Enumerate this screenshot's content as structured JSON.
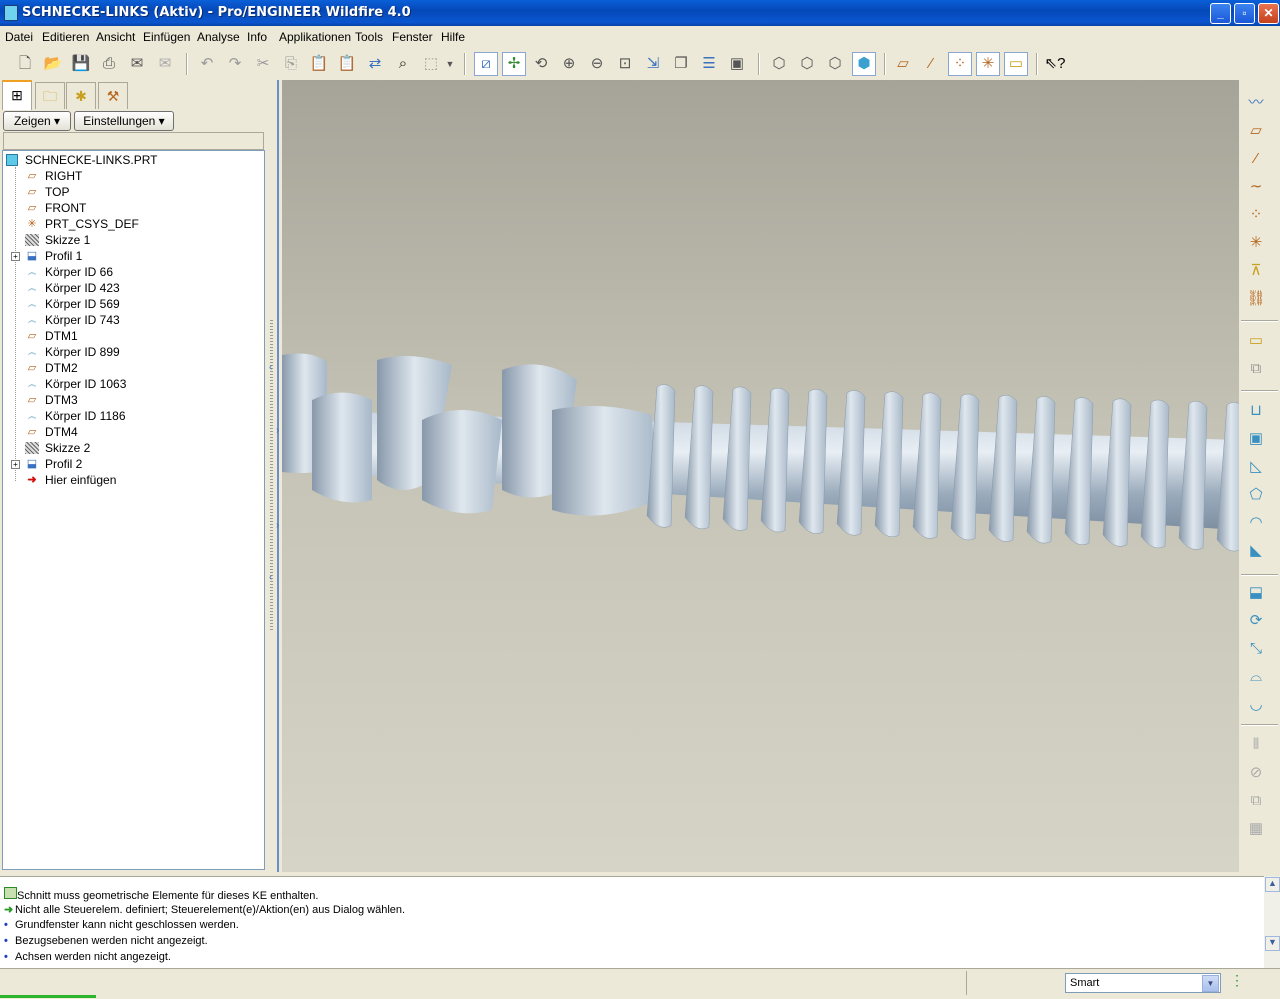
{
  "window": {
    "title": "SCHNECKE-LINKS (Aktiv) - Pro/ENGINEER Wildfire 4.0",
    "controls": [
      "minimize",
      "maximize",
      "close"
    ]
  },
  "menu": [
    "Datei",
    "Editieren",
    "Ansicht",
    "Einfügen",
    "Analyse",
    "Info",
    "Applikationen",
    "Tools",
    "Fenster",
    "Hilfe"
  ],
  "toolbar_icons": [
    "new-file-icon",
    "open-folder-icon",
    "save-icon",
    "print-icon",
    "email-icon",
    "email-link-icon",
    "undo-icon",
    "redo-icon",
    "cut-icon",
    "copy-icon",
    "paste-icon",
    "paste-special-icon",
    "regenerate-icon",
    "find-icon",
    "select-box-icon",
    "repaint-icon",
    "spin-center-icon",
    "orientation-icon",
    "zoom-in-icon",
    "zoom-out-icon",
    "refit-icon",
    "reorient-icon",
    "saved-views-icon",
    "layers-icon",
    "view-manager-icon",
    "wireframe-icon",
    "hidden-line-icon",
    "no-hidden-icon",
    "shading-icon",
    "datum-planes-icon",
    "datum-axes-icon",
    "datum-points-icon",
    "coord-systems-icon",
    "annotations-icon",
    "context-help-icon"
  ],
  "panel": {
    "tabs": [
      "model-tree-icon",
      "folder-browser-icon",
      "favorites-icon",
      "connections-icon"
    ],
    "show_button": "Zeigen",
    "settings_button": "Einstellungen"
  },
  "tree": {
    "root": "SCHNECKE-LINKS.PRT",
    "items": [
      {
        "label": "RIGHT",
        "icon": "datum-plane-icon",
        "expandable": false
      },
      {
        "label": "TOP",
        "icon": "datum-plane-icon",
        "expandable": false
      },
      {
        "label": "FRONT",
        "icon": "datum-plane-icon",
        "expandable": false
      },
      {
        "label": "PRT_CSYS_DEF",
        "icon": "coord-system-icon",
        "expandable": false
      },
      {
        "label": "Skizze 1",
        "icon": "sketch-icon",
        "expandable": false
      },
      {
        "label": "Profil 1",
        "icon": "extrude-icon",
        "expandable": true
      },
      {
        "label": "Körper ID 66",
        "icon": "helical-sweep-icon",
        "expandable": false
      },
      {
        "label": "Körper ID 423",
        "icon": "helical-sweep-icon",
        "expandable": false
      },
      {
        "label": "Körper ID 569",
        "icon": "helical-sweep-icon",
        "expandable": false
      },
      {
        "label": "Körper ID 743",
        "icon": "helical-sweep-icon",
        "expandable": false
      },
      {
        "label": "DTM1",
        "icon": "datum-plane-icon",
        "expandable": false
      },
      {
        "label": "Körper ID 899",
        "icon": "helical-sweep-icon",
        "expandable": false
      },
      {
        "label": "DTM2",
        "icon": "datum-plane-icon",
        "expandable": false
      },
      {
        "label": "Körper ID 1063",
        "icon": "helical-sweep-icon",
        "expandable": false
      },
      {
        "label": "DTM3",
        "icon": "datum-plane-icon",
        "expandable": false
      },
      {
        "label": "Körper ID 1186",
        "icon": "helical-sweep-icon",
        "expandable": false
      },
      {
        "label": "DTM4",
        "icon": "datum-plane-icon",
        "expandable": false
      },
      {
        "label": "Skizze 2",
        "icon": "sketch-icon",
        "expandable": false
      },
      {
        "label": "Profil 2",
        "icon": "extrude-icon",
        "expandable": true
      },
      {
        "label": "Hier einfügen",
        "icon": "insert-here-arrow-icon",
        "expandable": false
      }
    ]
  },
  "messages": [
    {
      "icon": "section-warning-icon",
      "text": "Schnitt muss geometrische Elemente für dieses KE enthalten."
    },
    {
      "icon": "green-arrow-icon",
      "text": "Nicht alle Steuerelem. definiert; Steuerelement(e)/Aktion(en) aus Dialog wählen."
    },
    {
      "icon": "bullet-icon",
      "text": "Grundfenster kann nicht geschlossen werden."
    },
    {
      "icon": "bullet-icon",
      "text": "Bezugsebenen werden nicht angezeigt."
    },
    {
      "icon": "bullet-icon",
      "text": "Achsen werden nicht angezeigt."
    }
  ],
  "status": {
    "filter_value": "Smart"
  },
  "right_toolbar_icons": [
    "sketch-tool-icon",
    "datum-plane-tool-icon",
    "datum-axis-tool-icon",
    "datum-curve-tool-icon",
    "datum-point-tool-icon",
    "datum-csys-tool-icon",
    "analysis-feature-icon",
    "datum-link-icon",
    "view-icon",
    "mirror-geometry-icon",
    "hole-icon",
    "shell-icon",
    "rib-icon",
    "draft-icon",
    "round-icon",
    "chamfer-icon",
    "extrude-tool-icon",
    "revolve-tool-icon",
    "sweep-tool-icon",
    "blend-tool-icon",
    "surface-tool-icon",
    "mirror-tool-icon",
    "pattern-icon",
    "merge-icon",
    "trim-icon"
  ],
  "colors": {
    "title_bar": "#0a5fd8",
    "chrome": "#ece9d8",
    "graphics_bg": "#c5c3b5",
    "screw": "#a8b8c8"
  }
}
